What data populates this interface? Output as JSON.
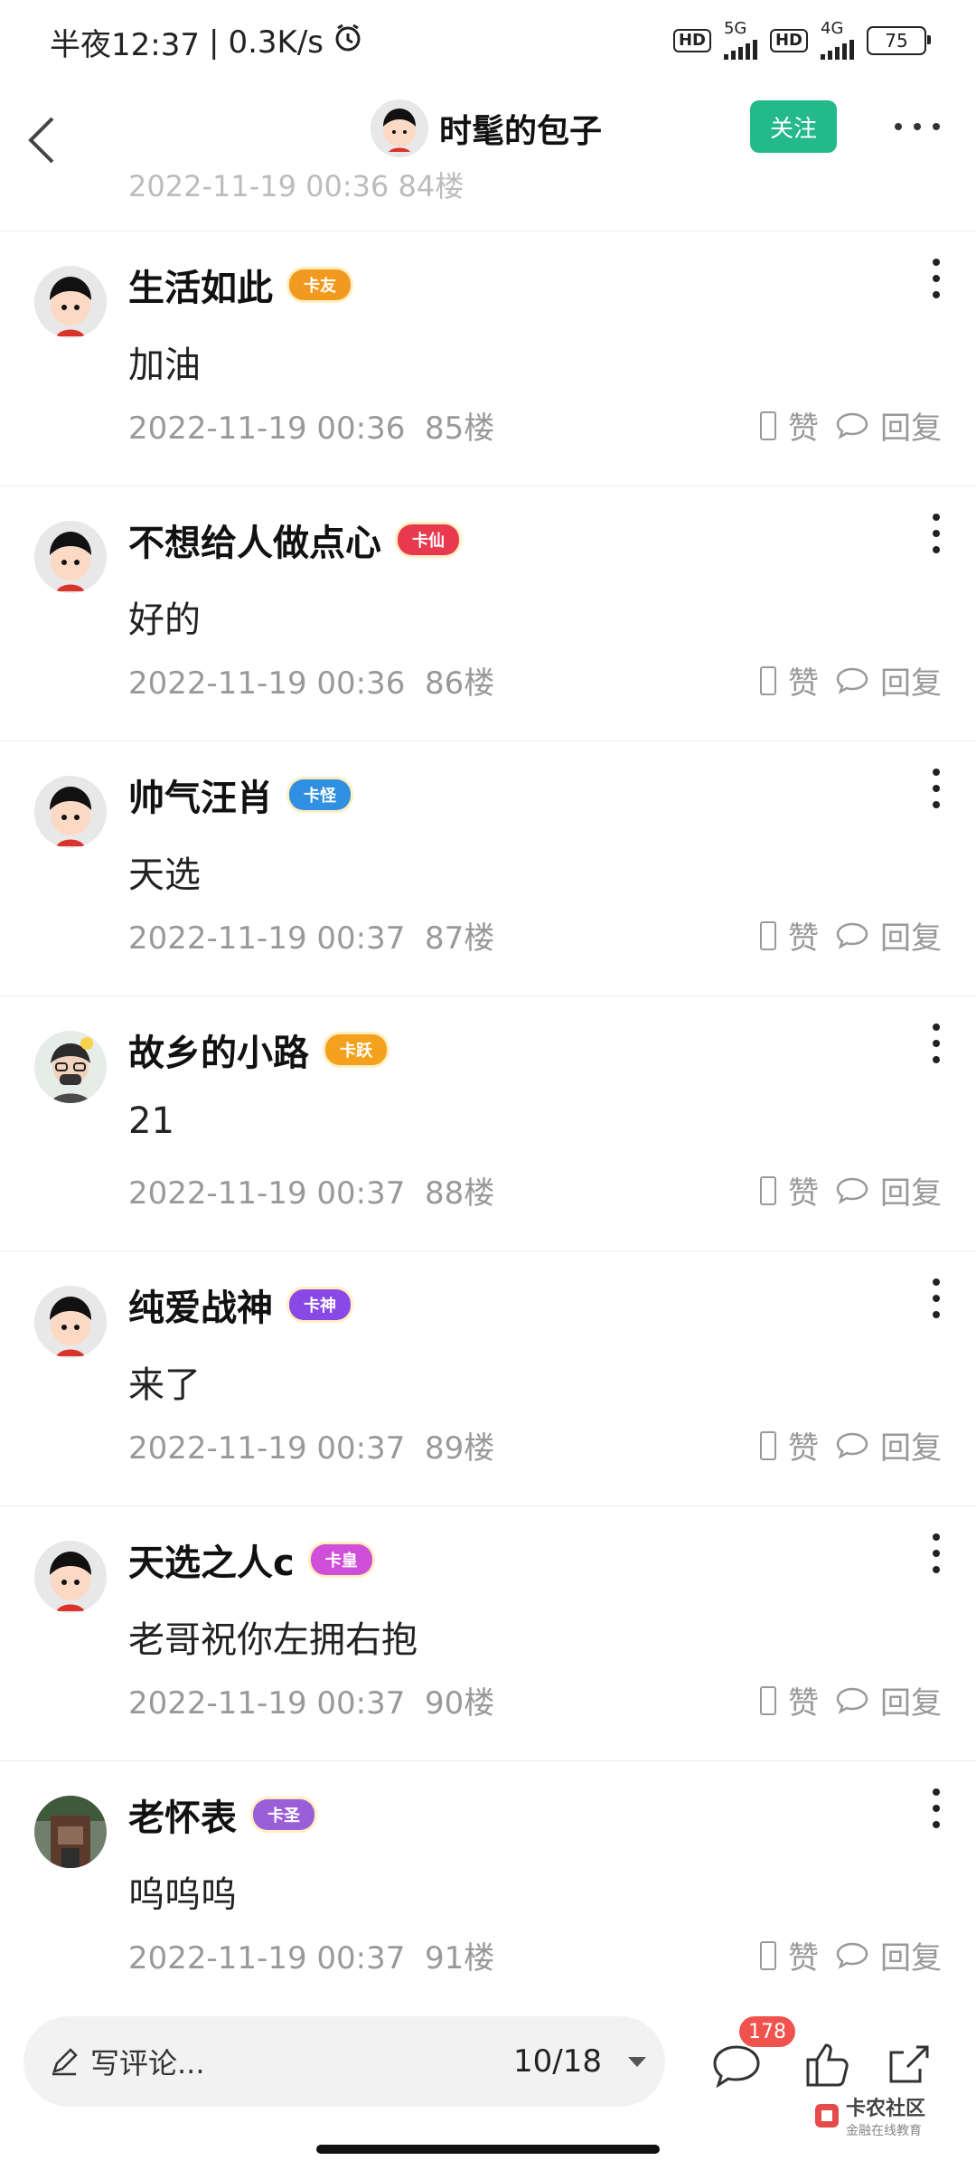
{
  "status_bar": {
    "time": "半夜12:37",
    "speed": "0.3K/s",
    "hd": "HD",
    "net1": "5G",
    "net2": "4G",
    "battery": "75"
  },
  "header": {
    "title": "时髦的包子",
    "follow_label": "关注"
  },
  "cutoff_row": {
    "meta": "2022-11-19 00:36  84楼",
    "like": "赞",
    "reply": "回复"
  },
  "comments": [
    {
      "name": "生活如此",
      "badge": "卡友",
      "badge_color": "#f29a1f",
      "text": "加油",
      "time": "2022-11-19 00:36",
      "floor": "85楼",
      "like": "赞",
      "reply": "回复"
    },
    {
      "name": "不想给人做点心",
      "badge": "卡仙",
      "badge_color": "#e8394f",
      "text": "好的",
      "time": "2022-11-19 00:36",
      "floor": "86楼",
      "like": "赞",
      "reply": "回复"
    },
    {
      "name": "帅气汪肖",
      "badge": "卡怪",
      "badge_color": "#2f8fe0",
      "text": "天选",
      "time": "2022-11-19 00:37",
      "floor": "87楼",
      "like": "赞",
      "reply": "回复"
    },
    {
      "name": "故乡的小路",
      "badge": "卡跃",
      "badge_color": "#f4a21e",
      "text": "21",
      "time": "2022-11-19 00:37",
      "floor": "88楼",
      "like": "赞",
      "reply": "回复"
    },
    {
      "name": "纯爱战神",
      "badge": "卡神",
      "badge_color": "#8a49e6",
      "text": "来了",
      "time": "2022-11-19 00:37",
      "floor": "89楼",
      "like": "赞",
      "reply": "回复"
    },
    {
      "name": "天选之人c",
      "badge": "卡皇",
      "badge_color": "#d04fd8",
      "text": "老哥祝你左拥右抱",
      "time": "2022-11-19 00:37",
      "floor": "90楼",
      "like": "赞",
      "reply": "回复"
    },
    {
      "name": "老怀表",
      "badge": "卡圣",
      "badge_color": "#9a5fd8",
      "text": "呜呜呜",
      "time": "2022-11-19 00:37",
      "floor": "91楼",
      "like": "赞",
      "reply": "回复"
    }
  ],
  "bottom_bar": {
    "comment_placeholder": "写评论...",
    "page": "10/18",
    "comment_count": "178",
    "brand_title": "卡农社区",
    "brand_sub": "金融在线教育"
  }
}
